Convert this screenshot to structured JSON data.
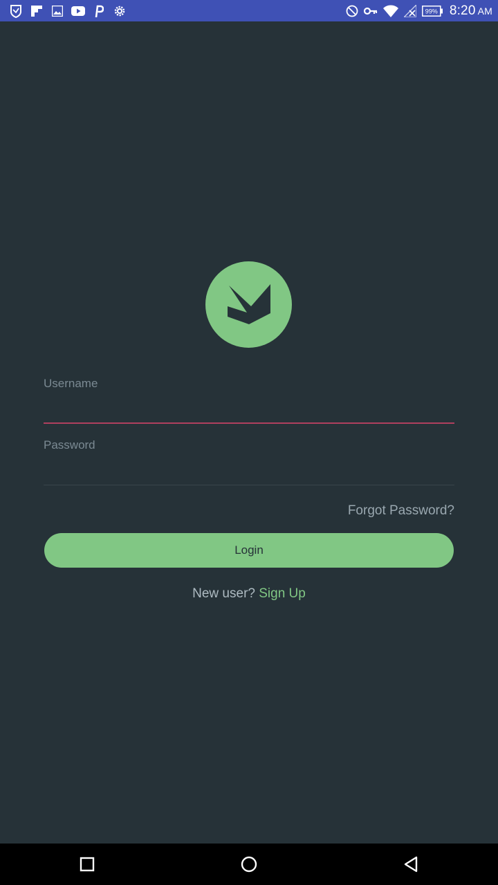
{
  "status_bar": {
    "time": "8:20",
    "ampm": "AM",
    "battery": "99%",
    "left_icons": [
      "shield-icon",
      "flipboard-icon",
      "gallery-icon",
      "youtube-icon",
      "pinterest-icon",
      "settings-gear-icon"
    ],
    "right_icons": [
      "do-not-disturb-icon",
      "vpn-key-icon",
      "wifi-icon",
      "no-signal-icon",
      "battery-icon"
    ],
    "colors": {
      "background": "#3f51b5"
    }
  },
  "logo": {
    "icon": "app-logo-icon",
    "color": "#81c784"
  },
  "form": {
    "username": {
      "label": "Username",
      "value": ""
    },
    "password": {
      "label": "Password",
      "value": ""
    },
    "forgot_password": "Forgot Password?",
    "login_label": "Login",
    "new_user_prompt": "New user?",
    "sign_up_label": "Sign Up"
  },
  "nav_bar": {
    "buttons": [
      "recents-icon",
      "home-icon",
      "back-icon"
    ]
  },
  "colors": {
    "background": "#263238",
    "accent": "#81c784",
    "focused_underline": "#b0405f"
  }
}
